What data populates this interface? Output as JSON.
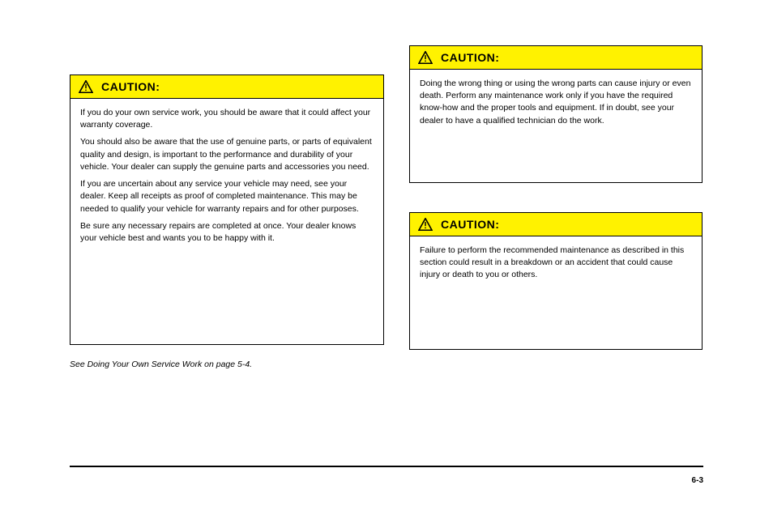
{
  "box1": {
    "title": "CAUTION:",
    "paragraphs": [
      "If you do your own service work, you should be aware that it could affect your warranty coverage.",
      "You should also be aware that the use of genuine parts, or parts of equivalent quality and design, is important to the performance and durability of your vehicle. Your dealer can supply the genuine parts and accessories you need.",
      "If you are uncertain about any service your vehicle may need, see your dealer. Keep all receipts as proof of completed maintenance. This may be needed to qualify your vehicle for warranty repairs and for other purposes.",
      "Be sure any necessary repairs are completed at once. Your dealer knows your vehicle best and wants you to be happy with it."
    ]
  },
  "box2": {
    "title": "CAUTION:",
    "paragraphs": [
      "Doing the wrong thing or using the wrong parts can cause injury or even death. Perform any maintenance work only if you have the required know-how and the proper tools and equipment. If in doubt, see your dealer to have a qualified technician do the work."
    ]
  },
  "box3": {
    "title": "CAUTION:",
    "paragraphs": [
      "Failure to perform the recommended maintenance as described in this section could result in a breakdown or an accident that could cause injury or death to you or others."
    ]
  },
  "footnote": "See Doing Your Own Service Work on page 5-4.",
  "page_number": "6-3",
  "footer_code": ""
}
